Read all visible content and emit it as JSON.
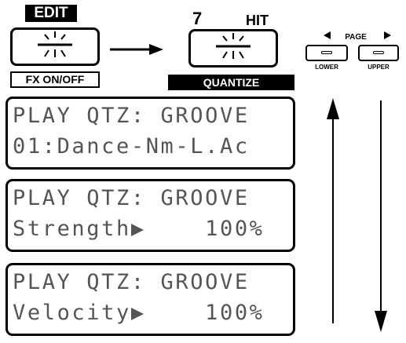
{
  "buttons": {
    "edit": {
      "top_label": "EDIT",
      "bottom_label": "FX ON/OFF"
    },
    "hit": {
      "number": "7",
      "label": "HIT",
      "bottom_label": "QUANTIZE"
    },
    "page": {
      "title": "PAGE",
      "lower": "LOWER",
      "upper": "UPPER"
    }
  },
  "screens": [
    {
      "line1": "PLAY QTZ: GROOVE",
      "line2": "01:Dance-Nm-L.Ac"
    },
    {
      "line1": "PLAY QTZ: GROOVE",
      "line2": "Strength▶    100%"
    },
    {
      "line1": "PLAY QTZ: GROOVE",
      "line2": "Velocity▶    100%"
    }
  ],
  "icons": {
    "lamp": "lit-led-icon",
    "flow": "right-arrow-icon",
    "up": "up-arrow-icon",
    "down": "down-arrow-icon"
  }
}
